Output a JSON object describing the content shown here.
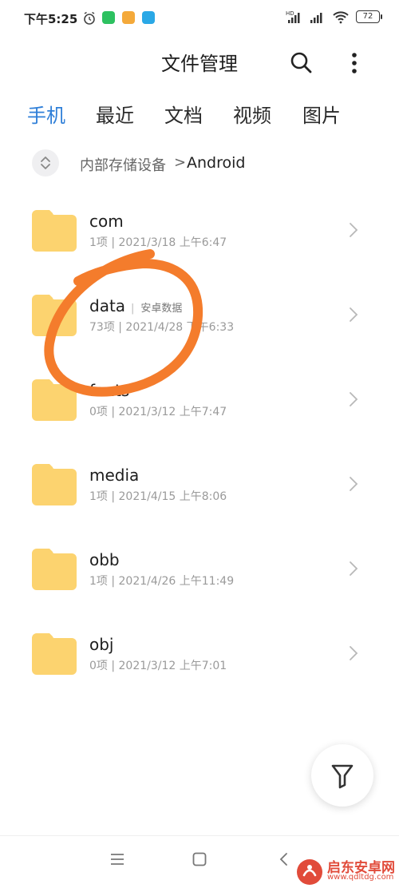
{
  "status_bar": {
    "time": "下午5:25",
    "signal_label": "HD",
    "battery": "72"
  },
  "header": {
    "title": "文件管理"
  },
  "tabs": [
    {
      "label": "手机",
      "active": true
    },
    {
      "label": "最近",
      "active": false
    },
    {
      "label": "文档",
      "active": false
    },
    {
      "label": "视频",
      "active": false
    },
    {
      "label": "图片",
      "active": false
    }
  ],
  "breadcrumb": {
    "parent": "内部存储设备",
    "separator": ">",
    "current": "Android"
  },
  "folders": [
    {
      "name": "com",
      "tag": "",
      "meta": "1项 | 2021/3/18 上午6:47"
    },
    {
      "name": "data",
      "tag": "安卓数据",
      "meta": "73项 | 2021/4/28 下午6:33"
    },
    {
      "name": "fonts",
      "tag": "",
      "meta": "0项 | 2021/3/12 上午7:47"
    },
    {
      "name": "media",
      "tag": "",
      "meta": "1项 | 2021/4/15 上午8:06"
    },
    {
      "name": "obb",
      "tag": "",
      "meta": "1项 | 2021/4/26 上午11:49"
    },
    {
      "name": "obj",
      "tag": "",
      "meta": "0项 | 2021/3/12 上午7:01"
    }
  ],
  "colors": {
    "accent": "#2f7fd8",
    "folder": "#fcd36f",
    "annotation": "#f47c2c"
  },
  "watermark": {
    "title": "启东安卓网",
    "url": "www.qdltdg.com"
  }
}
